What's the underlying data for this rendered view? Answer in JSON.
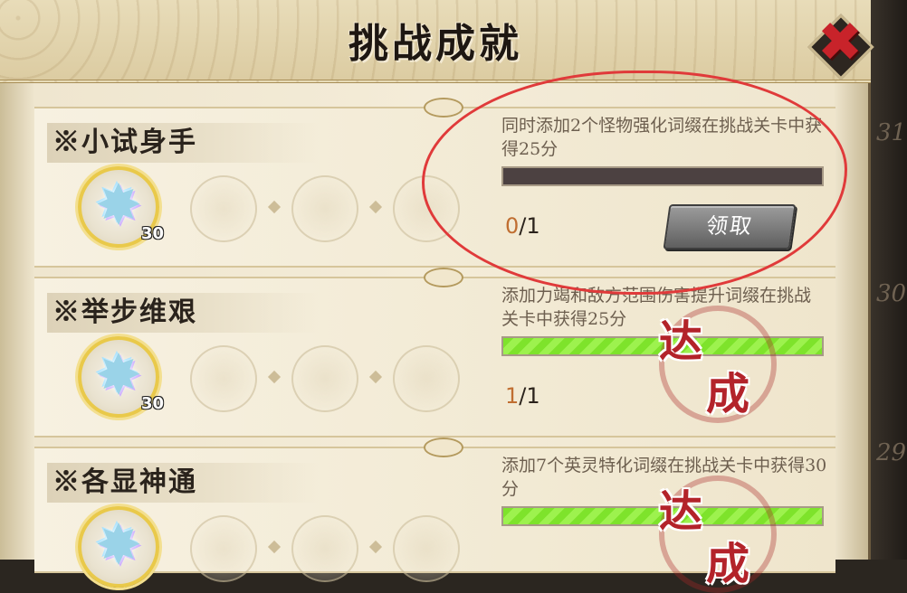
{
  "title": "挑战成就",
  "close_icon_glyph": "✖",
  "colors": {
    "progress_empty": "#4c4141",
    "progress_full": "#7ee32b",
    "progress_current": "#c06e31",
    "stamp_red": "#b3232a",
    "annotation_red": "#e03a3a"
  },
  "background_ghost_numbers": [
    "31",
    "30",
    "29"
  ],
  "achievements": [
    {
      "name": "※小试身手",
      "reward_icon": "crystal-star-icon",
      "reward_count": "30",
      "description": "同时添加2个怪物强化词缀在挑战关卡中获得25分",
      "progress_current": "0",
      "progress_total": "/1",
      "progress_fraction": 0,
      "claim_label": "领取",
      "completed": false
    },
    {
      "name": "※举步维艰",
      "reward_icon": "crystal-star-icon",
      "reward_count": "30",
      "description": "添加力竭和敌方范围伤害提升词缀在挑战关卡中获得25分",
      "progress_current": "1",
      "progress_total": "/1",
      "progress_fraction": 1,
      "stamp_line1": "达",
      "stamp_line2": "成",
      "completed": true
    },
    {
      "name": "※各显神通",
      "reward_icon": "crystal-star-icon",
      "reward_count": "",
      "description": "添加7个英灵特化词缀在挑战关卡中获得30分",
      "progress_fraction": 1,
      "stamp_line1": "达",
      "stamp_line2": "成",
      "completed": true
    }
  ]
}
